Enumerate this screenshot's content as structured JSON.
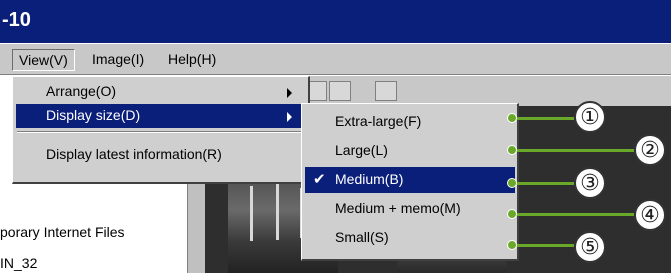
{
  "window": {
    "title": "-10"
  },
  "menubar": {
    "items": [
      {
        "label": "View(V)"
      },
      {
        "label": "Image(I)"
      },
      {
        "label": "Help(H)"
      }
    ]
  },
  "left_pane": {
    "lines": [
      "porary Internet Files",
      "IN_32"
    ]
  },
  "view_menu": {
    "items": [
      {
        "label": "Arrange(O)",
        "has_submenu": true
      },
      {
        "label": "Display size(D)",
        "has_submenu": true,
        "highlighted": true
      },
      {
        "label": "Display latest information(R)"
      }
    ]
  },
  "display_size_menu": {
    "items": [
      {
        "label": "Extra-large(F)",
        "callout": "①"
      },
      {
        "label": "Large(L)",
        "callout": "②"
      },
      {
        "label": "Medium(B)",
        "checked": true,
        "highlighted": true,
        "callout": "③"
      },
      {
        "label": "Medium + memo(M)",
        "callout": "④"
      },
      {
        "label": "Small(S)",
        "callout": "⑤"
      }
    ],
    "check_glyph": "✔"
  },
  "colors": {
    "title_bar": "#0a1f7a",
    "highlight": "#0a1f7a",
    "menu_bg": "#cfcfcf",
    "callout_green": "#6aa82a"
  }
}
